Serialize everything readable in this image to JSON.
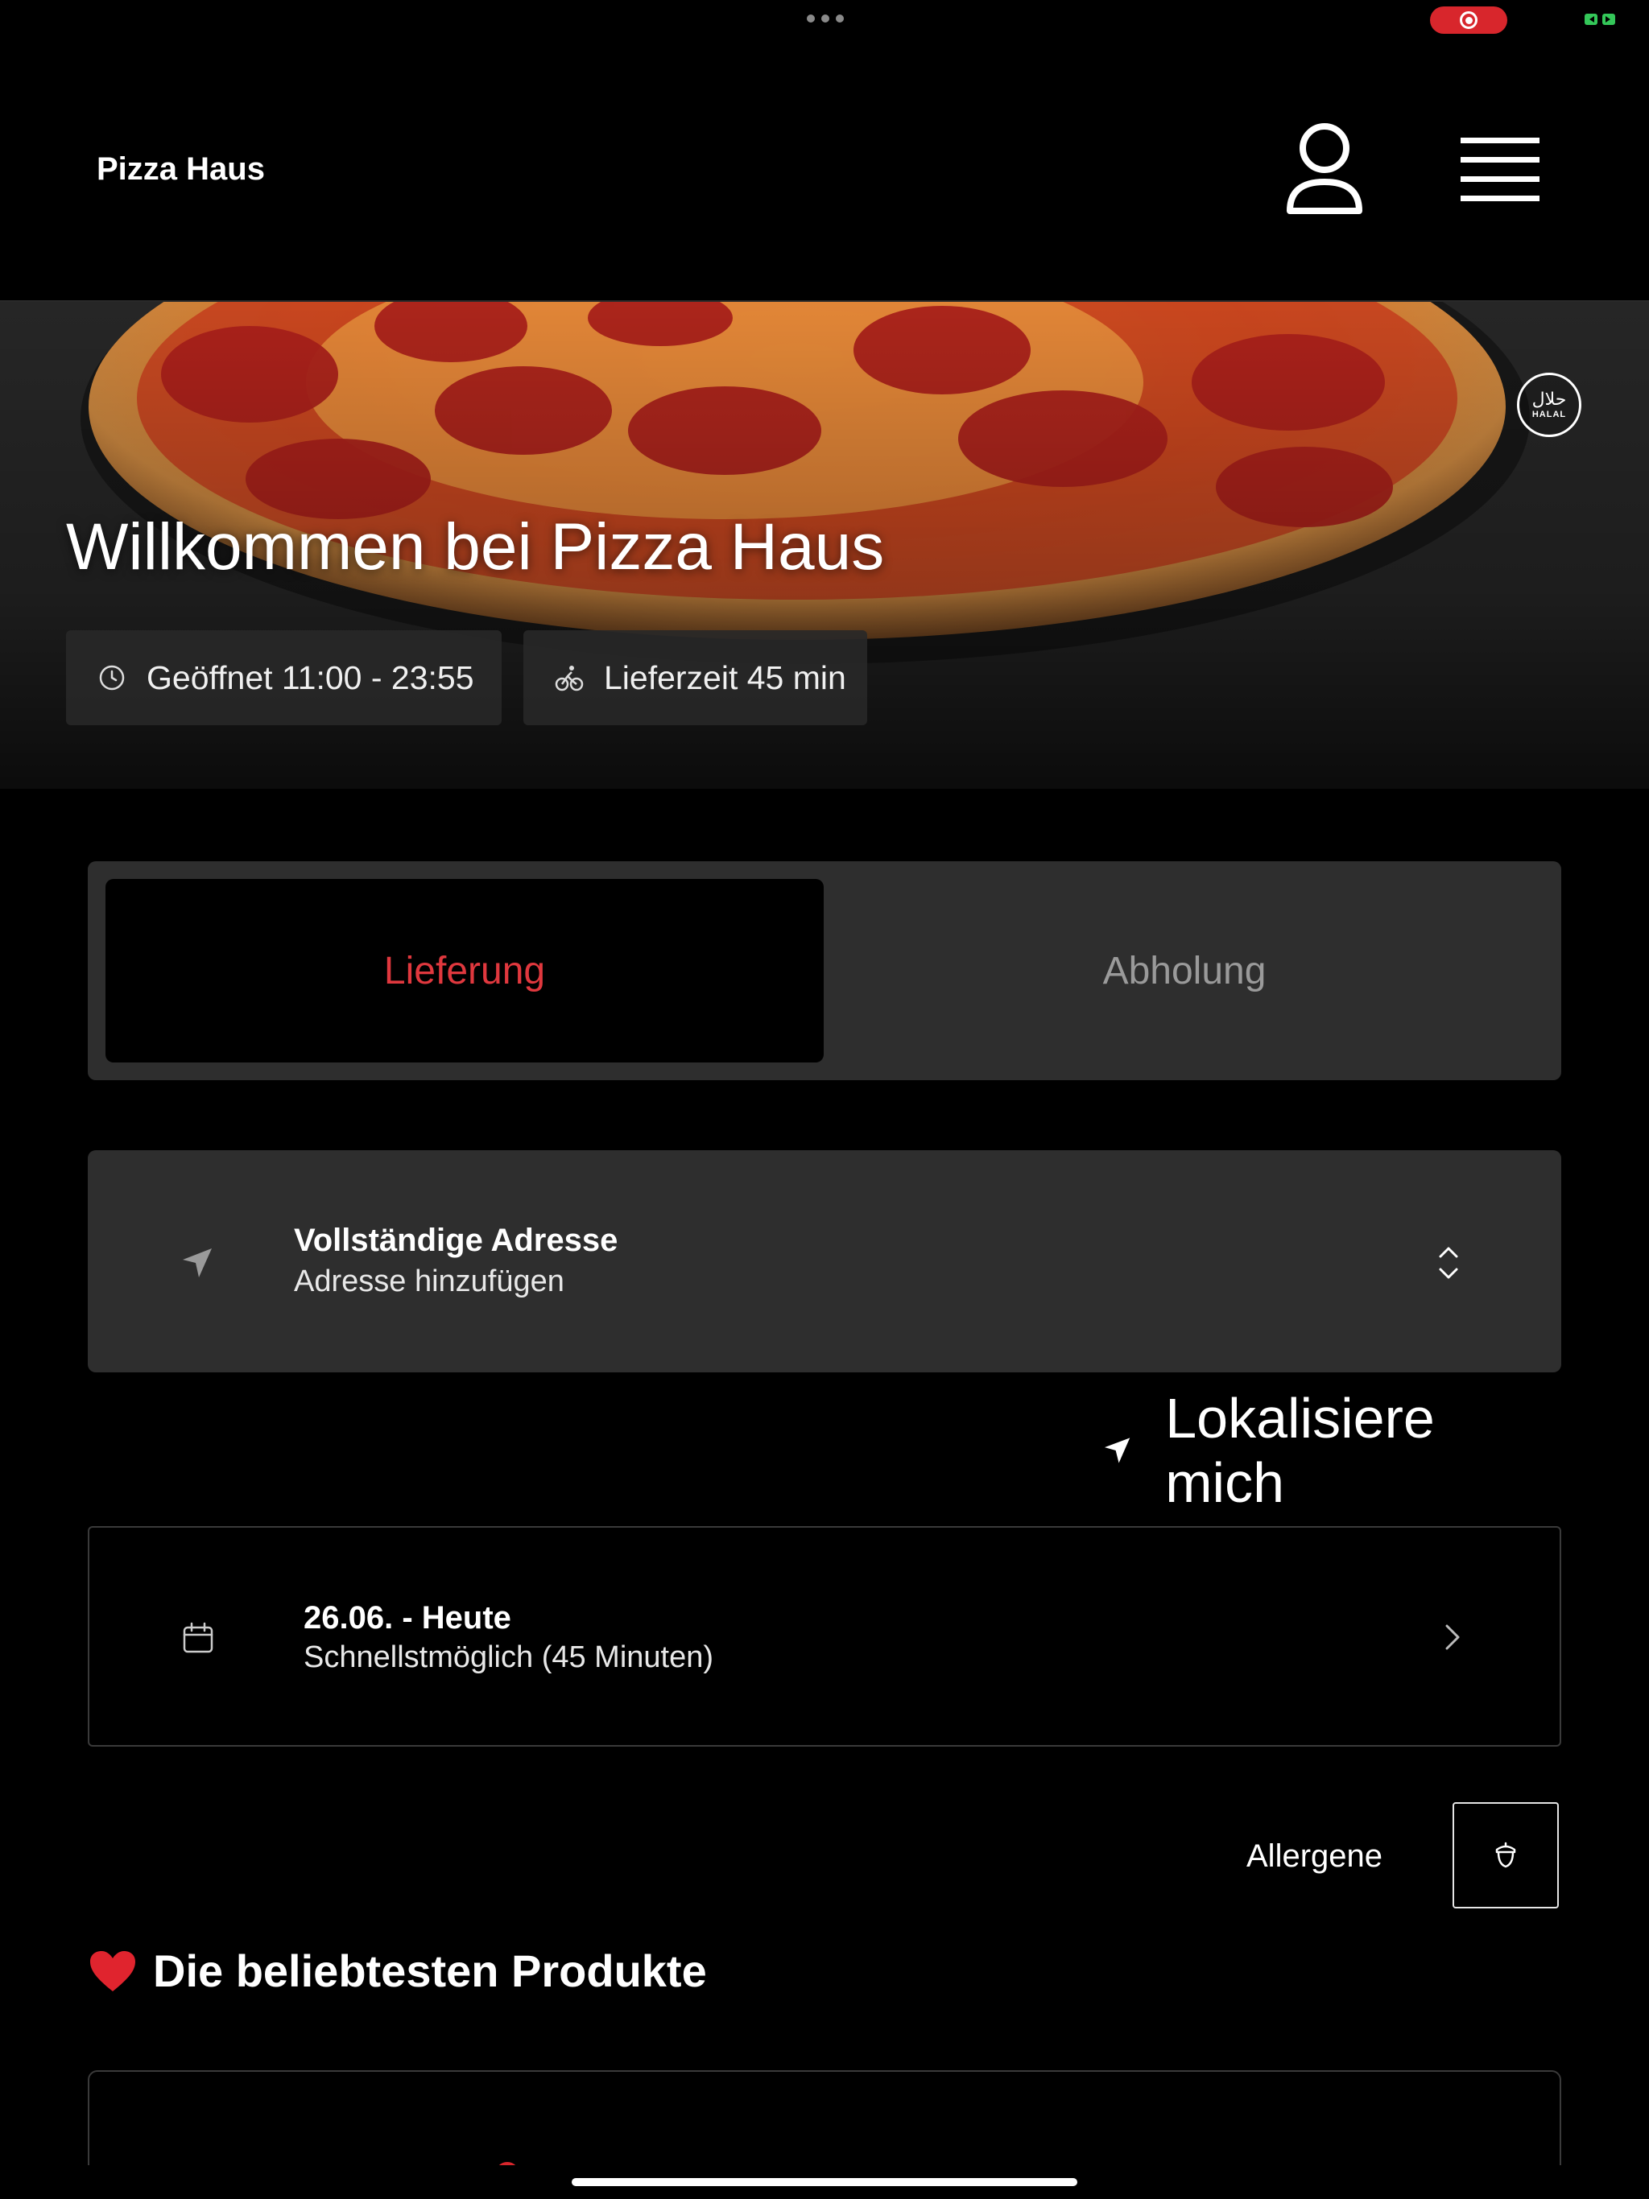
{
  "header": {
    "brand": "Pizza Haus"
  },
  "hero": {
    "title": "Willkommen bei Pizza Haus",
    "halal_badge_ar": "حلال",
    "halal_badge_text": "HALAL",
    "hours_chip": "Geöffnet 11:00 - 23:55",
    "delivery_chip": "Lieferzeit 45 min"
  },
  "tabs": {
    "delivery": "Lieferung",
    "pickup": "Abholung",
    "active": "delivery"
  },
  "address": {
    "title": "Vollständige Adresse",
    "subtitle": "Adresse hinzufügen"
  },
  "localize": {
    "label": "Lokalisiere mich"
  },
  "schedule": {
    "date": "26.06. - Heute",
    "time": "Schnellstmöglich (45 Minuten)"
  },
  "allergens": {
    "label": "Allergene"
  },
  "section": {
    "title": "Die beliebtesten Produkte"
  },
  "colors": {
    "accent": "#e0383e",
    "background": "#000000",
    "card": "#2e2e2e"
  }
}
